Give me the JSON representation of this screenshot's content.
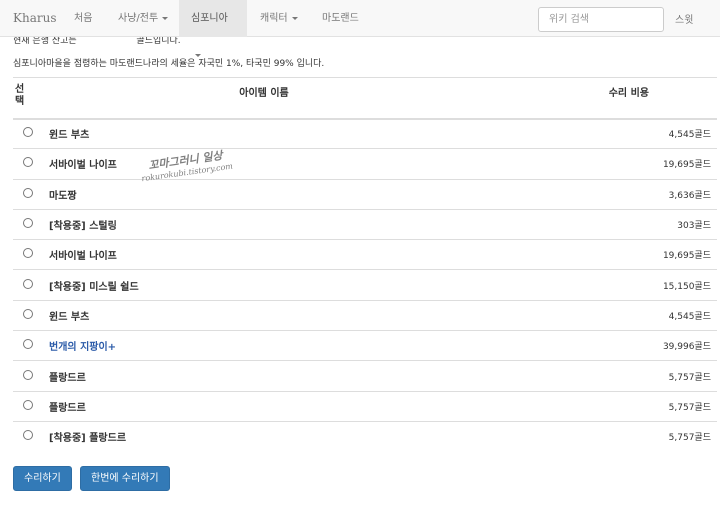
{
  "nav": {
    "brand": "Kharus",
    "items": [
      {
        "label": "처음",
        "active": false,
        "dropdown": false
      },
      {
        "label": "사냥/전투",
        "active": false,
        "dropdown": true
      },
      {
        "label": "심포니아",
        "active": true,
        "dropdown": true
      },
      {
        "label": "캐릭터",
        "active": false,
        "dropdown": true
      },
      {
        "label": "마도랜드",
        "active": false,
        "dropdown": false
      }
    ],
    "search_placeholder": "위키 검색",
    "search_button": "스윗"
  },
  "info": {
    "line1": "현재 은행 잔고는 　　　　　　 골드입니다.",
    "line2": "심포니아마을을 점령하는 마도랜드나라의 세율은 자국민 1%, 타국민 99% 입니다."
  },
  "table": {
    "headers": {
      "select": "선택",
      "name": "아이템 이름",
      "cost": "수리 비용"
    },
    "rows": [
      {
        "name": "윈드 부츠",
        "cost": "4,545골드",
        "link": false
      },
      {
        "name": "서바이벌 나이프",
        "cost": "19,695골드",
        "link": false
      },
      {
        "name": "마도짱",
        "cost": "3,636골드",
        "link": false
      },
      {
        "name": "[착용중] 스털링",
        "cost": "303골드",
        "link": false
      },
      {
        "name": "서바이벌 나이프",
        "cost": "19,695골드",
        "link": false
      },
      {
        "name": "[착용중] 미스릴 쉴드",
        "cost": "15,150골드",
        "link": false
      },
      {
        "name": "윈드 부츠",
        "cost": "4,545골드",
        "link": false
      },
      {
        "name": "번개의 지팡이+",
        "cost": "39,996골드",
        "link": true
      },
      {
        "name": "플랑드르",
        "cost": "5,757골드",
        "link": false
      },
      {
        "name": "플랑드르",
        "cost": "5,757골드",
        "link": false
      },
      {
        "name": "[착용중] 플랑드르",
        "cost": "5,757골드",
        "link": false
      }
    ]
  },
  "buttons": {
    "repair": "수리하기",
    "repair_all": "한번에 수리하기"
  },
  "watermark": {
    "line1": "꼬마그러니 일상",
    "line2": "rokurokubi.tistory.com"
  }
}
